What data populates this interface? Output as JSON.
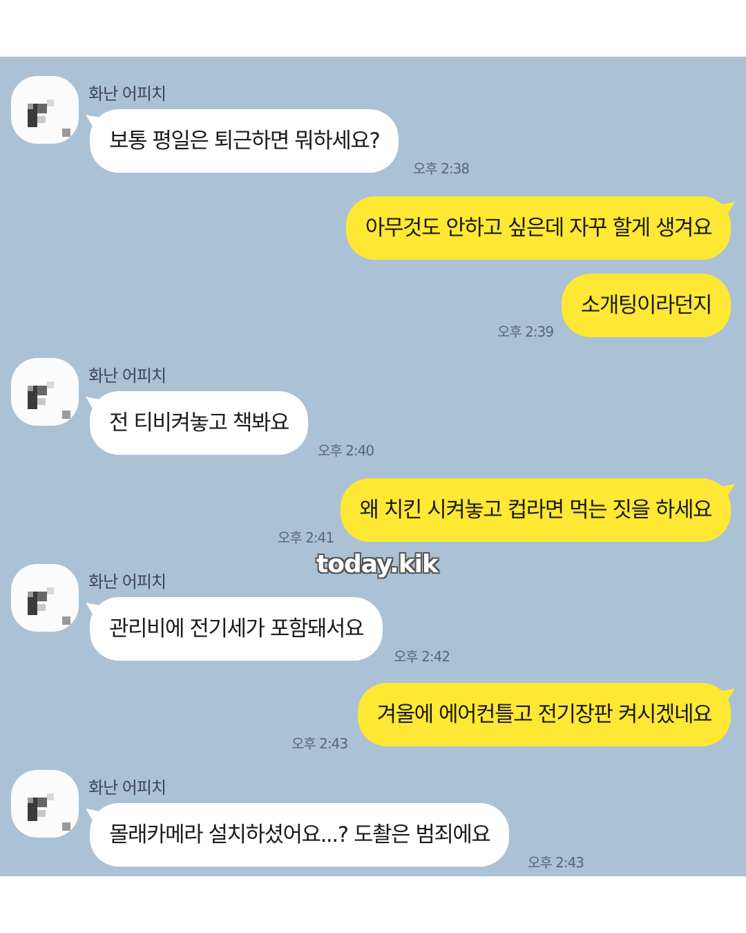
{
  "sender_name": "화난 어피치",
  "messages": [
    {
      "text": "보통 평일은 퇴근하면 뭐하세요?",
      "time": "오후 2:38"
    },
    {
      "text": "아무것도 안하고 싶은데 자꾸 할게 생겨요",
      "time": ""
    },
    {
      "text": "소개팅이라던지",
      "time": "오후 2:39"
    },
    {
      "text": "전 티비켜놓고 책봐요",
      "time": "오후 2:40"
    },
    {
      "text": "왜 치킨 시켜놓고 컵라면 먹는 짓을 하세요",
      "time": "오후 2:41"
    },
    {
      "text": "관리비에 전기세가 포함돼서요",
      "time": "오후 2:42"
    },
    {
      "text": "겨울에 에어컨틀고 전기장판 켜시겠네요",
      "time": "오후 2:43"
    },
    {
      "text": "몰래카메라 설치하셨어요...? 도촬은 범죄에요",
      "time": "오후 2:43"
    }
  ],
  "watermark": "today.kik",
  "colors": {
    "background": "#abc1d6",
    "incoming_bubble": "#ffffff",
    "outgoing_bubble": "#fee833"
  }
}
